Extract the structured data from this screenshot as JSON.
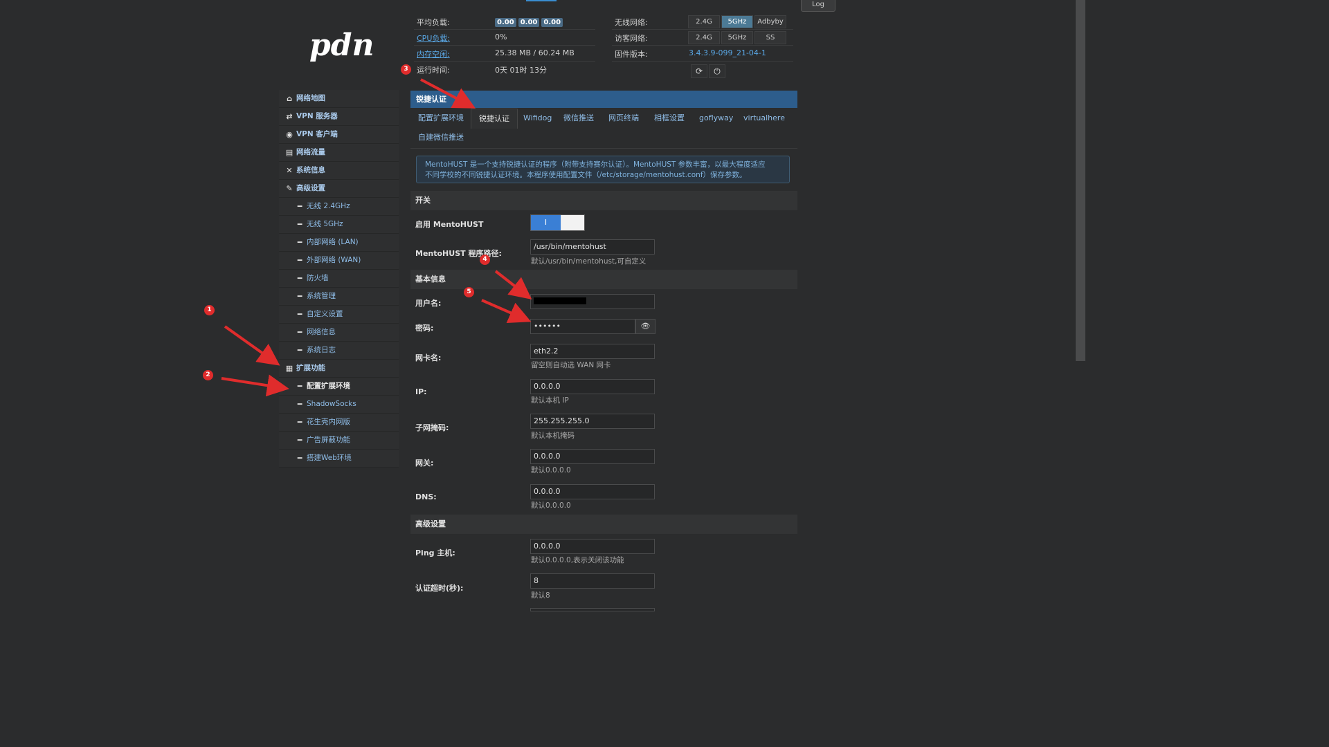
{
  "top": {
    "log_label": "Log"
  },
  "status": {
    "avg_load_label": "平均负载:",
    "load_values": [
      "0.00",
      "0.00",
      "0.00"
    ],
    "cpu_label": "CPU负载:",
    "cpu_value": "0%",
    "mem_label": "内存空闲:",
    "mem_value": "25.38 MB / 60.24 MB",
    "uptime_label": "运行时间:",
    "uptime_value": "0天 01时 13分",
    "wireless_label": "无线网络:",
    "wireless_buttons": [
      "2.4G",
      "5GHz",
      "Adbyby"
    ],
    "guest_label": "访客网络:",
    "guest_buttons": [
      "2.4G",
      "5GHz",
      "SS"
    ],
    "firmware_label": "固件版本:",
    "firmware_value": "3.4.3.9-099_21-04-1"
  },
  "sidebar": {
    "items": [
      {
        "icon": "⌂",
        "label": "网络地图"
      },
      {
        "icon": "⇄",
        "label": "VPN 服务器"
      },
      {
        "icon": "◉",
        "label": "VPN 客户端"
      },
      {
        "icon": "▤",
        "label": "网络流量"
      },
      {
        "icon": "✕",
        "label": "系统信息"
      },
      {
        "icon": "✎",
        "label": "高级设置"
      }
    ],
    "advanced_sub": [
      "无线 2.4GHz",
      "无线 5GHz",
      "内部网络 (LAN)",
      "外部网络 (WAN)",
      "防火墙",
      "系统管理",
      "自定义设置",
      "网络信息",
      "系统日志"
    ],
    "ext_label": "扩展功能",
    "ext_icon": "▦",
    "ext_sub": [
      "配置扩展环境",
      "ShadowSocks",
      "花生壳内网版",
      "广告屏蔽功能",
      "搭建Web环境"
    ]
  },
  "panel": {
    "title": "锐捷认证",
    "tabs": [
      "配置扩展环境",
      "锐捷认证",
      "Wifidog",
      "微信推送",
      "网页终端",
      "相框设置",
      "goflyway",
      "virtualhere",
      "自建微信推送"
    ],
    "info_line1": "MentoHUST 是一个支持锐捷认证的程序（附带支持赛尔认证）。MentoHUST 参数丰富，以最大程度适应",
    "info_line2": "不同学校的不同锐捷认证环境。本程序使用配置文件（/etc/storage/mentohust.conf）保存参数。"
  },
  "form": {
    "section_switch": "开关",
    "enable_label": "启用 MentoHUST",
    "toggle_on": "I",
    "path_label": "MentoHUST 程序路径:",
    "path_value": "/usr/bin/mentohust",
    "path_hint": "默认/usr/bin/mentohust,可自定义",
    "section_basic": "基本信息",
    "user_label": "用户名:",
    "pwd_label": "密码:",
    "pwd_value": "••••••",
    "nic_label": "网卡名:",
    "nic_value": "eth2.2",
    "nic_hint": "留空则自动选 WAN 网卡",
    "ip_label": "IP:",
    "ip_value": "0.0.0.0",
    "ip_hint": "默认本机 IP",
    "mask_label": "子网掩码:",
    "mask_value": "255.255.255.0",
    "mask_hint": "默认本机掩码",
    "gw_label": "网关:",
    "gw_value": "0.0.0.0",
    "gw_hint": "默认0.0.0.0",
    "dns_label": "DNS:",
    "dns_value": "0.0.0.0",
    "dns_hint": "默认0.0.0.0",
    "section_adv": "高级设置",
    "ping_label": "Ping 主机:",
    "ping_value": "0.0.0.0",
    "ping_hint": "默认0.0.0.0,表示关闭该功能",
    "timeout_label": "认证超时(秒):",
    "timeout_value": "8",
    "timeout_hint": "默认8"
  },
  "annotations": [
    "1",
    "2",
    "3",
    "4",
    "5"
  ]
}
